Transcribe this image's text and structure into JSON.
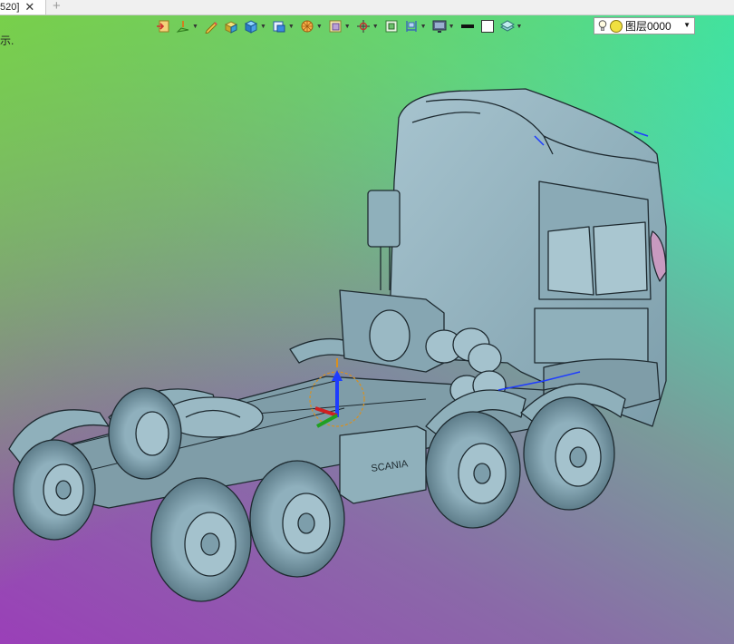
{
  "tab": {
    "title": "520]",
    "close": "✕",
    "new": "+"
  },
  "hint_text": "示.",
  "toolbar": {
    "icons": [
      {
        "name": "import-icon",
        "dropdown": false
      },
      {
        "name": "point-snap-icon",
        "dropdown": true
      },
      {
        "name": "pencil-icon",
        "dropdown": false
      },
      {
        "name": "box-solid-icon",
        "dropdown": false
      },
      {
        "name": "shaded-cube-icon",
        "dropdown": true
      },
      {
        "name": "view-cube-icon",
        "dropdown": true
      },
      {
        "name": "render-mode-icon",
        "dropdown": true
      },
      {
        "name": "section-view-icon",
        "dropdown": true
      },
      {
        "name": "axis-triad-icon",
        "dropdown": true
      },
      {
        "name": "fit-view-icon",
        "dropdown": false
      },
      {
        "name": "dimension-icon",
        "dropdown": true
      },
      {
        "name": "monitor-icon",
        "dropdown": true
      },
      {
        "name": "line-color-icon",
        "dropdown": false
      },
      {
        "name": "fill-color-icon",
        "dropdown": false
      },
      {
        "name": "layers-icon",
        "dropdown": true
      }
    ]
  },
  "layer_select": {
    "value": "图层0000"
  },
  "colors": {
    "model": "#8fb3c0",
    "model_edge": "#1e2a30",
    "accent_blue": "#1e3cff"
  }
}
